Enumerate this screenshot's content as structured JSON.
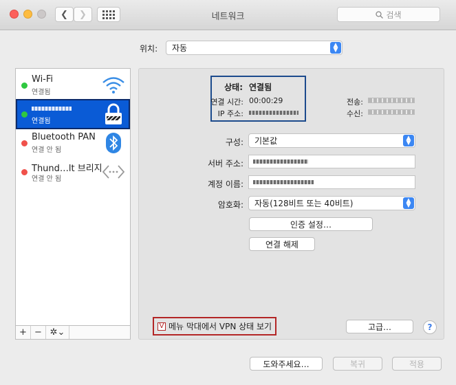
{
  "window": {
    "title": "네트워크",
    "search_placeholder": "검색"
  },
  "location": {
    "label": "위치:",
    "value": "자동"
  },
  "services": [
    {
      "name": "Wi-Fi",
      "status": "연결됨",
      "color": "#2fc840"
    },
    {
      "name": "",
      "status": "연결됨",
      "color": "#2fc840"
    },
    {
      "name": "Bluetooth PAN",
      "status": "연결 안 됨",
      "color": "#f0514b"
    },
    {
      "name": "Thund…lt 브리지",
      "status": "연결 안 됨",
      "color": "#f0514b"
    }
  ],
  "status": {
    "state_label": "상태:",
    "state_value": "연결됨",
    "time_label": "연결 시간:",
    "time_value": "00:00:29",
    "ip_label": "IP 주소:",
    "sent_label": "전송:",
    "recv_label": "수신:"
  },
  "form": {
    "config_label": "구성:",
    "config_value": "기본값",
    "server_label": "서버 주소:",
    "account_label": "계정 이름:",
    "encrypt_label": "암호화:",
    "encrypt_value": "자동(128비트 또는 40비트)",
    "auth_button": "인증 설정…",
    "disconnect_button": "연결 해제"
  },
  "vpn_menu": {
    "label": "메뉴 막대에서 VPN 상태 보기",
    "checked_glyph": "V"
  },
  "advanced_button": "고급…",
  "help_glyph": "?",
  "footer": {
    "assist": "도와주세요…",
    "revert": "복귀",
    "apply": "적용"
  },
  "sidebar_buttons": {
    "add": "+",
    "remove": "−",
    "gear": "✲⌄"
  },
  "colors": {
    "accent": "#0a5bd6",
    "highlight": "#1b4a8c",
    "warning_border": "#b32525"
  }
}
